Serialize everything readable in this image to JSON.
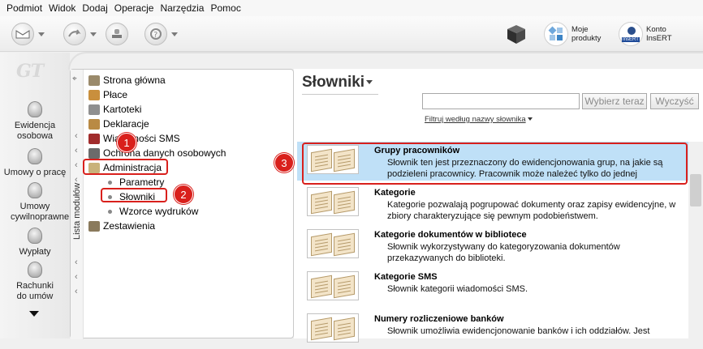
{
  "menu": [
    "Podmiot",
    "Widok",
    "Dodaj",
    "Operacje",
    "Narzędzia",
    "Pomoc"
  ],
  "toolbar": {
    "moje_produkty": [
      "Moje",
      "produkty"
    ],
    "konto": [
      "Konto",
      "InsERT"
    ],
    "konto_badge": "InsERT"
  },
  "logo": "GT",
  "sidebar": [
    {
      "label": "Ewidencja osobowa"
    },
    {
      "label": "Umowy o pracę"
    },
    {
      "label": "Umowy cywilnoprawne"
    },
    {
      "label": "Wypłaty"
    },
    {
      "label": "Rachunki do umów"
    }
  ],
  "modules": {
    "vertical_label": "Lista modułów",
    "items": [
      {
        "label": "Strona główna",
        "color": "#9a8a6b"
      },
      {
        "label": "Płace",
        "color": "#c98f3d"
      },
      {
        "label": "Kartoteki",
        "color": "#8f8f8f"
      },
      {
        "label": "Deklaracje",
        "color": "#b98a44"
      },
      {
        "label": "Wiadomości SMS",
        "color": "#a12c2c"
      },
      {
        "label": "Ochrona danych osobowych",
        "color": "#6b6b6b"
      },
      {
        "label": "Administracja",
        "color": "#c9b27a"
      },
      {
        "label": "Parametry"
      },
      {
        "label": "Słowniki"
      },
      {
        "label": "Wzorce wydruków"
      },
      {
        "label": "Zestawienia",
        "color": "#8a7a5c"
      }
    ]
  },
  "main": {
    "title": "Słowniki",
    "search_placeholder": "",
    "search_button": "Wybierz teraz",
    "clear_button": "Wyczyść",
    "filter_link": "Filtruj według nazwy słownika",
    "items": [
      {
        "title": "Grupy pracowników",
        "desc": "Słownik ten jest przeznaczony do ewidencjonowania grup, na jakie są podzieleni pracownicy. Pracownik może należeć tylko do jednej"
      },
      {
        "title": "Kategorie",
        "desc": "Kategorie pozwalają pogrupować dokumenty oraz zapisy ewidencyjne, w zbiory charakteryzujące się pewnym podobieństwem."
      },
      {
        "title": "Kategorie dokumentów w bibliotece",
        "desc": "Słownik wykorzystywany do kategoryzowania dokumentów przekazywanych do biblioteki."
      },
      {
        "title": "Kategorie SMS",
        "desc": "Słownik kategorii wiadomości SMS."
      },
      {
        "title": "Numery rozliczeniowe banków",
        "desc": "Słownik umożliwia ewidencjonowanie banków i ich oddziałów. Jest"
      }
    ]
  },
  "annotations": [
    "1",
    "2",
    "3"
  ],
  "colors": {
    "highlight": "#d9201c",
    "selected_row": "#bfe0f7"
  }
}
